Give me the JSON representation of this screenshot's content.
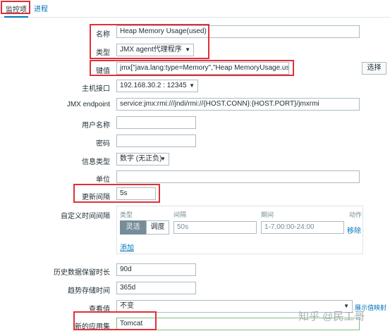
{
  "tabs": [
    "监控项",
    "进程"
  ],
  "form": {
    "name": {
      "label": "名称",
      "value": "Heap Memory Usage(used)"
    },
    "type": {
      "label": "类型",
      "value": "JMX agent代理程序"
    },
    "key": {
      "label": "键值",
      "value": "jmx[\"java.lang:type=Memory\",\"Heap MemoryUsage.used\"]",
      "button": "选择"
    },
    "host_interface": {
      "label": "主机接口",
      "value": "192.168.30.2 : 12345"
    },
    "jmx_endpoint": {
      "label": "JMX endpoint",
      "value": "service:jmx:rmi:///jndi/rmi://{HOST.CONN}:{HOST.PORT}/jmxrmi"
    },
    "username": {
      "label": "用户名称",
      "value": ""
    },
    "password": {
      "label": "密码",
      "value": ""
    },
    "info_type": {
      "label": "信息类型",
      "value": "数字 (无正负)"
    },
    "unit": {
      "label": "单位",
      "value": ""
    },
    "update_interval": {
      "label": "更新间隔",
      "value": "5s"
    },
    "custom_intervals": {
      "label": "自定义时间间隔",
      "headers": {
        "type": "类型",
        "interval": "间隔",
        "period": "期间",
        "action": "动作"
      },
      "row": {
        "flexible": "灵活",
        "scheduling": "调度",
        "interval": "50s",
        "period": "1-7,00:00-24:00",
        "remove": "移除"
      },
      "add": "添加"
    },
    "history": {
      "label": "历史数据保留时长",
      "value": "90d"
    },
    "trends": {
      "label": "趋势存储时间",
      "value": "365d"
    },
    "show_value": {
      "label": "查看值",
      "value": "不变",
      "link": "展示值映射"
    },
    "new_app": {
      "label": "新的应用集",
      "value": "Tomcat"
    }
  },
  "watermark": "知乎 @民工哥",
  "colors": {
    "highlight": "#e0303a",
    "link": "#0275b8",
    "border": "#acbbc2"
  }
}
